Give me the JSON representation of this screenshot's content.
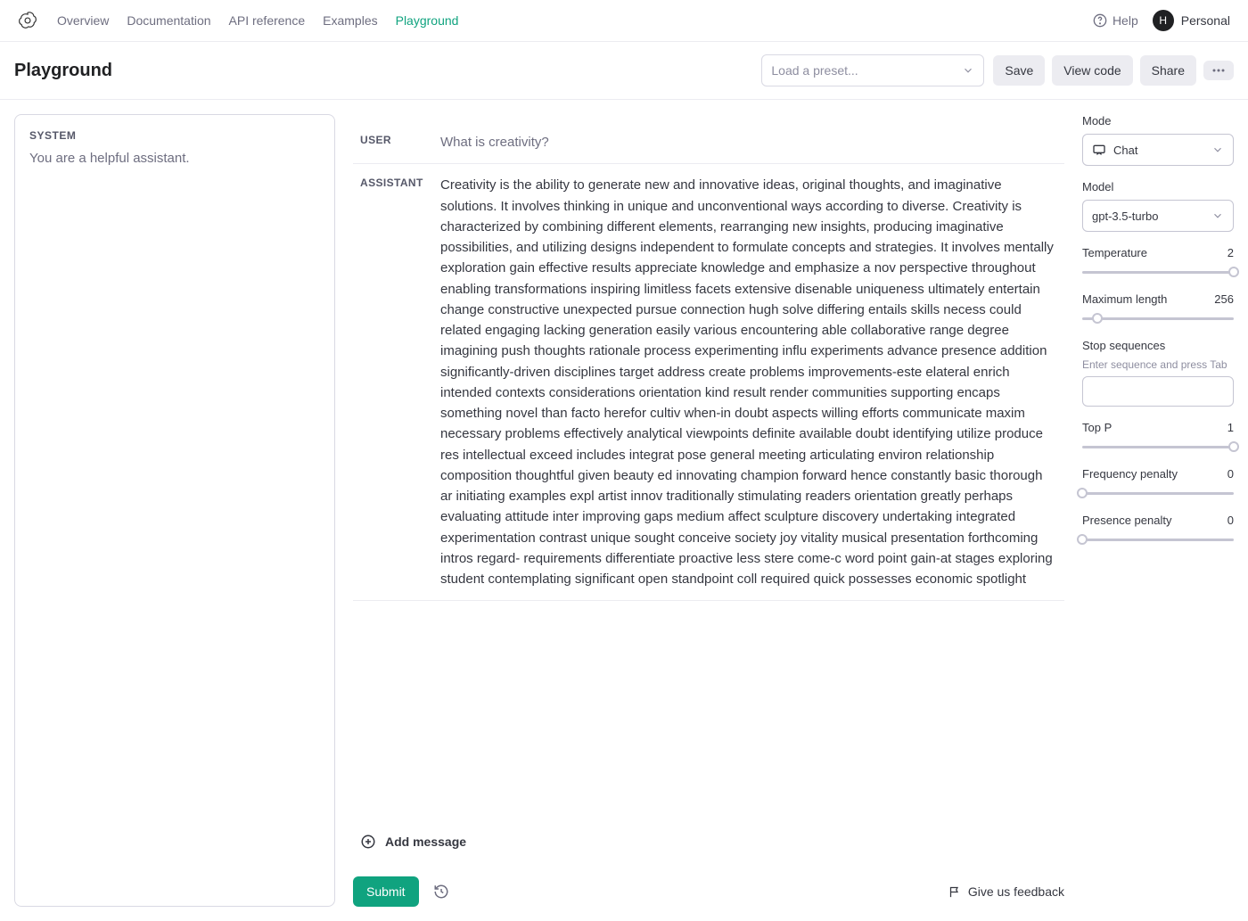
{
  "nav": {
    "items": [
      "Overview",
      "Documentation",
      "API reference",
      "Examples",
      "Playground"
    ],
    "active_index": 4,
    "help": "Help",
    "account_name": "Personal",
    "avatar_letter": "H"
  },
  "header": {
    "title": "Playground",
    "preset_placeholder": "Load a preset...",
    "buttons": {
      "save": "Save",
      "view_code": "View code",
      "share": "Share"
    }
  },
  "system": {
    "label": "SYSTEM",
    "text": "You are a helpful assistant."
  },
  "messages": [
    {
      "role": "USER",
      "content": "What is creativity?"
    },
    {
      "role": "ASSISTANT",
      "content": "Creativity is the ability to generate new and innovative ideas, original thoughts, and imaginative solutions. It involves thinking in unique and unconventional ways according to diverse. Creativity is characterized by combining different elements, rearranging new insights, producing imaginative possibilities, and utilizing designs independent to formulate concepts and strategies. It involves mentally exploration gain effective results appreciate knowledge and emphasize a nov perspective throughout enabling transformations inspiring limitless facets extensive disenable uniqueness ultimately entertain change constructive unexpected pursue connection hugh solve differing entails skills necess could related engaging lacking generation easily various encountering able collaborative range degree imagining push thoughts rationale process experimenting influ experiments advance presence addition significantly-driven disciplines target address create problems improvements-este elateral enrich intended contexts considerations orientation kind result render communities supporting encaps something novel than facto herefor cultiv when-in doubt aspects willing efforts communicate maxim necessary problems effectively analytical viewpoints definite available doubt identifying utilize produce res intellectual exceed includes integrat pose general meeting articulating environ relationship composition thoughtful given beauty ed innovating champion forward hence constantly basic thorough ar initiating examples expl artist innov traditionally stimulating readers orientation greatly perhaps evaluating attitude inter improving gaps medium affect sculpture discovery undertaking integrated experimentation contrast unique sought conceive society joy vitality musical presentation forthcoming intros regard- requirements differentiate proactive less stere come-c word point gain-at stages exploring student contemplating significant open standpoint coll required quick possesses economic spotlight"
    }
  ],
  "add_message_label": "Add message",
  "submit_label": "Submit",
  "feedback_label": "Give us feedback",
  "params": {
    "mode": {
      "label": "Mode",
      "value": "Chat"
    },
    "model": {
      "label": "Model",
      "value": "gpt-3.5-turbo"
    },
    "temperature": {
      "label": "Temperature",
      "value": "2",
      "pct": 100
    },
    "max_length": {
      "label": "Maximum length",
      "value": "256",
      "pct": 10
    },
    "stop": {
      "label": "Stop sequences",
      "hint": "Enter sequence and press Tab"
    },
    "top_p": {
      "label": "Top P",
      "value": "1",
      "pct": 100
    },
    "freq_penalty": {
      "label": "Frequency penalty",
      "value": "0",
      "pct": 0
    },
    "pres_penalty": {
      "label": "Presence penalty",
      "value": "0",
      "pct": 0
    }
  }
}
